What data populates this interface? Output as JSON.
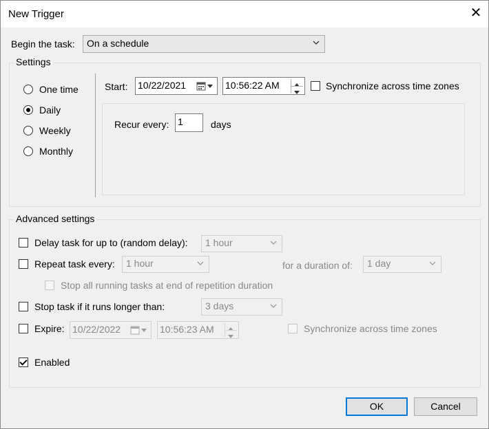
{
  "window": {
    "title": "New Trigger",
    "close_glyph": "✕"
  },
  "begin_task": {
    "label": "Begin the task:",
    "value": "On a schedule"
  },
  "settings": {
    "legend": "Settings",
    "radios": [
      {
        "label": "One time",
        "checked": false
      },
      {
        "label": "Daily",
        "checked": true
      },
      {
        "label": "Weekly",
        "checked": false
      },
      {
        "label": "Monthly",
        "checked": false
      }
    ],
    "start_label": "Start:",
    "start_date": "10/22/2021",
    "start_time": "10:56:22 AM",
    "sync_label": "Synchronize across time zones",
    "recur_label": "Recur every:",
    "recur_value": "1",
    "recur_unit": "days"
  },
  "advanced": {
    "legend": "Advanced settings",
    "delay_label": "Delay task for up to (random delay):",
    "delay_value": "1 hour",
    "repeat_label": "Repeat task every:",
    "repeat_value": "1 hour",
    "duration_label": "for a duration of:",
    "duration_value": "1 day",
    "stop_running_label": "Stop all running tasks at end of repetition duration",
    "stop_longer_label": "Stop task if it runs longer than:",
    "stop_longer_value": "3 days",
    "expire_label": "Expire:",
    "expire_date": "10/22/2022",
    "expire_time": "10:56:23 AM",
    "expire_sync_label": "Synchronize across time zones",
    "enabled_label": "Enabled",
    "enabled_checked": true
  },
  "buttons": {
    "ok": "OK",
    "cancel": "Cancel"
  },
  "colors": {
    "accent": "#0078d7",
    "dialog_bg": "#f0f0f0",
    "disabled_text": "#888888"
  }
}
